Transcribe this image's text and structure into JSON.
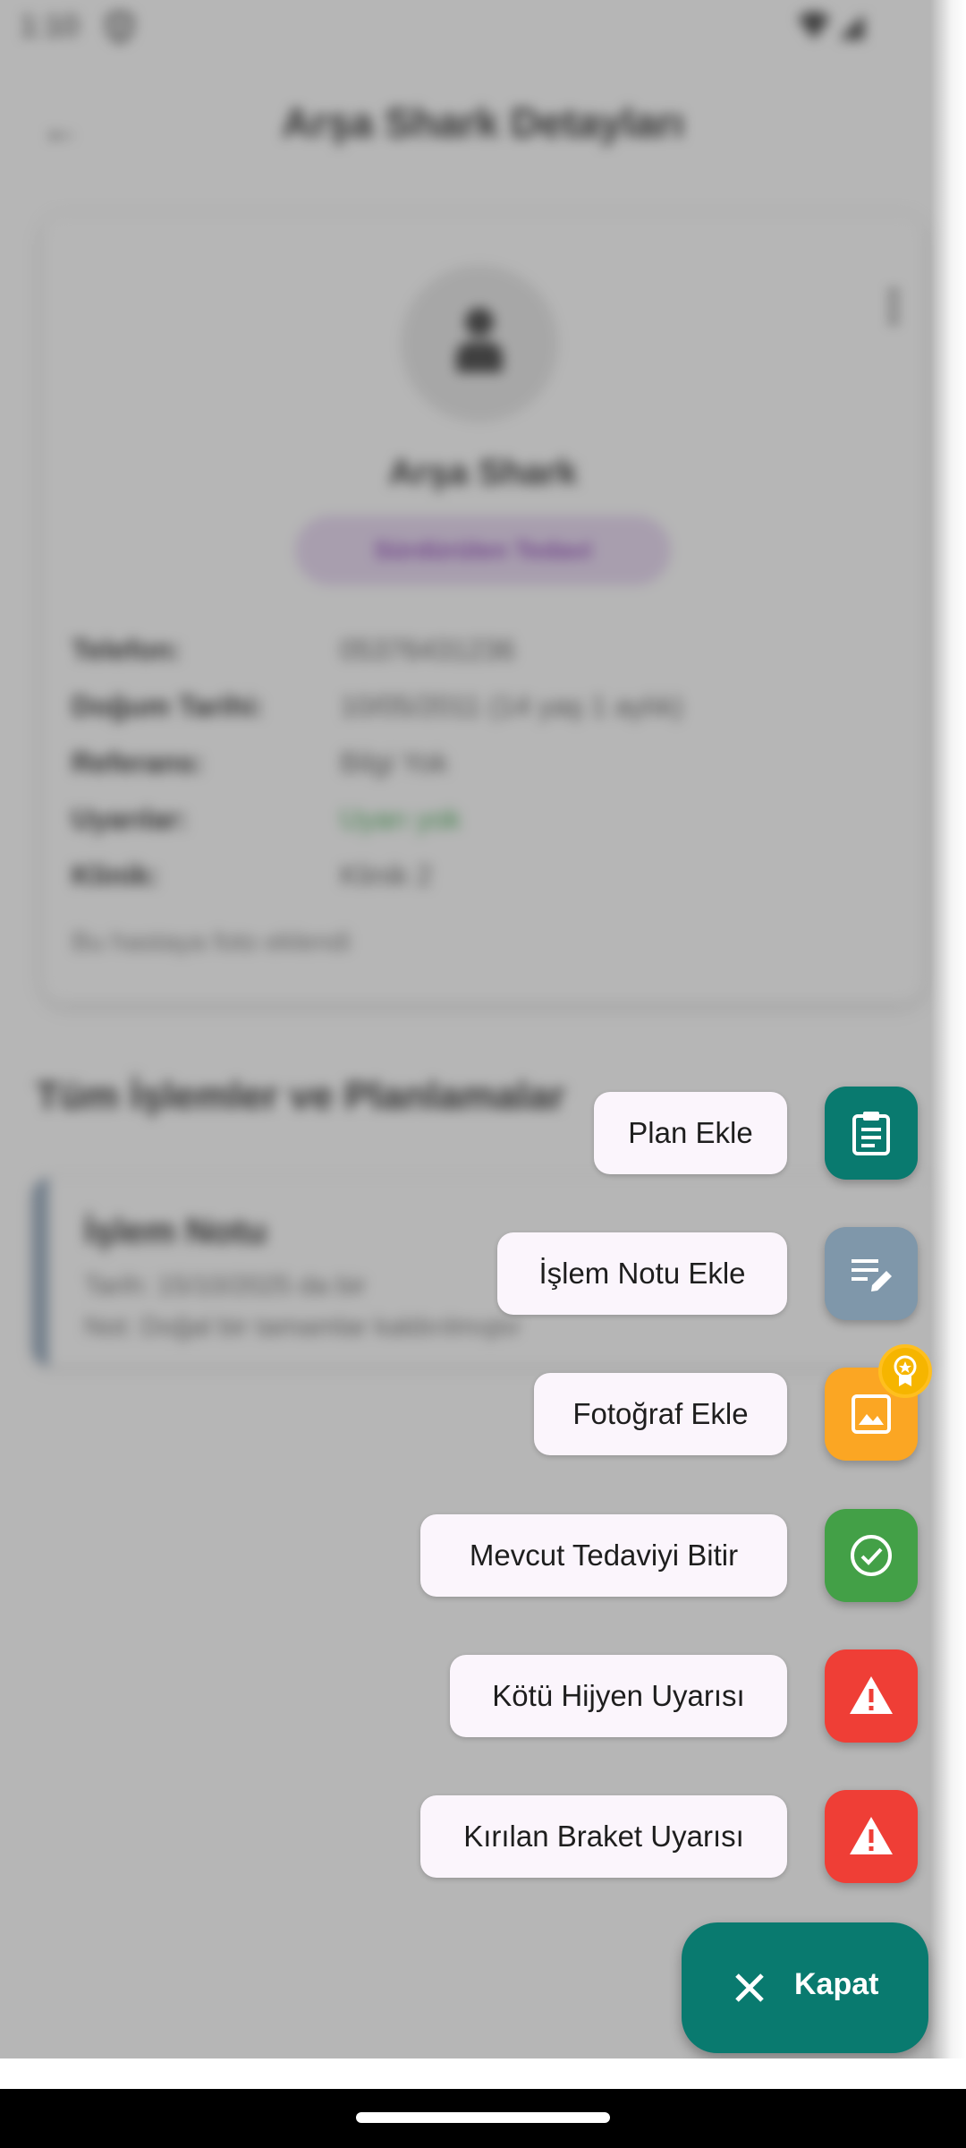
{
  "status_bar": {
    "time": "1:10"
  },
  "background": {
    "title": "Arşa Shark Detayları",
    "patient_name": "Arşa Shark",
    "status_chip": "Sürdürülen Tedavi",
    "info": [
      {
        "key": "Telefon:",
        "value": "05376431236"
      },
      {
        "key": "Doğum Tarihi:",
        "value": "10/05/2011 (14 yaş 1 aylık)"
      },
      {
        "key": "Referans:",
        "value": "Bilgi Yok"
      },
      {
        "key": "Uyarılar:",
        "value": "Uyarı yok"
      },
      {
        "key": "Klinik:",
        "value": "Klinik 2"
      }
    ],
    "info_note": "Bu hastaya foto eklendi",
    "section_title": "Tüm İşlemler ve Planlamalar",
    "note": {
      "title": "İşlem Notu",
      "date": "Tarih: 15/10/2025 da bir",
      "text": "Not: Doğal bir tamamlar kaldırılmıştır"
    }
  },
  "speed_dial": {
    "items": [
      {
        "label": "Plan Ekle",
        "icon": "clipboard-icon",
        "color": "#097a6f"
      },
      {
        "label": "İşlem Notu Ekle",
        "icon": "edit-note-icon",
        "color": "#7f97aa"
      },
      {
        "label": "Fotoğraf Ekle",
        "icon": "image-icon",
        "color": "#fba623"
      },
      {
        "label": "Mevcut Tedaviyi Bitir",
        "icon": "check-circle-icon",
        "color": "#43a047"
      },
      {
        "label": "Kötü Hijyen Uyarısı",
        "icon": "warning-icon",
        "color": "#ef3e36"
      },
      {
        "label": "Kırılan Braket Uyarısı",
        "icon": "warning-icon",
        "color": "#ef3e36"
      }
    ],
    "close_label": "Kapat"
  }
}
